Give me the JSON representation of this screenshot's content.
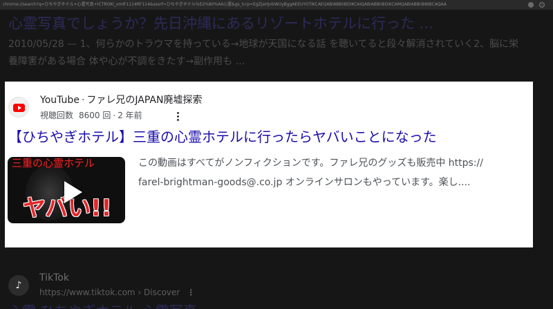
{
  "background": {
    "urlbar_text": "chrome://search?q=ひちやぎホテル+心霊写真+ICTROKI_xmlF1114RF114&sxsrf=ひちやぎホテル%E2%80%A6心霊&gs_lcrp=EgZjaHJvbWUyBggAEEUYOTIKCAEQABiABBiiBDIKCAIQABiABBiiBDIKCAMQABiABBiiBNIBCAQAA",
    "top_result": {
      "title": "心霊写真でしょうか？先日沖縄にあるリゾートホテルに行った ...",
      "snippet": "2010/05/28 — 1、何らかのトラウマを持っている→地球が天国になる話 を聴いてると段々解消されていく2、脳に栄養障害がある場合 体や心が不調をきたす→副作用も ..."
    },
    "tiktok": {
      "logo_glyph": "♪",
      "name": "TikTok",
      "url": "https://www.tiktok.com › Discover",
      "kebab": "⋮",
      "partial_title": "心霊 ひちやぎホテル 心霊写真"
    }
  },
  "card": {
    "source": {
      "site": "YouTube",
      "separator": "·",
      "channel": "ファレ兄のJAPAN廃墟探索",
      "logo_icon": "youtube-logo-icon"
    },
    "meta": {
      "views_label": "視聴回数",
      "views_count": "8600",
      "unit": "回",
      "dot": "·",
      "age": "2 年前"
    },
    "title": "【ひちやぎホテル】三重の心霊ホテルに行ったらヤバいことになった",
    "thumbnail": {
      "top_text": "三重の心霊ホテル",
      "bottom_text": "ヤバい!!",
      "play_icon": "play-icon"
    },
    "snippet_lines": [
      "この動画はすべてがノンフィクションです。ファレ兄のグッズも販売中 https://",
      "farel-brightman-goods@.co.jp オンラインサロンもやっています。楽し...."
    ]
  },
  "colors": {
    "link": "#1a0dab",
    "youtube_red": "#ff0000",
    "thumbnail_text_red": "#e3262a",
    "overlay_bg": "#161616"
  }
}
